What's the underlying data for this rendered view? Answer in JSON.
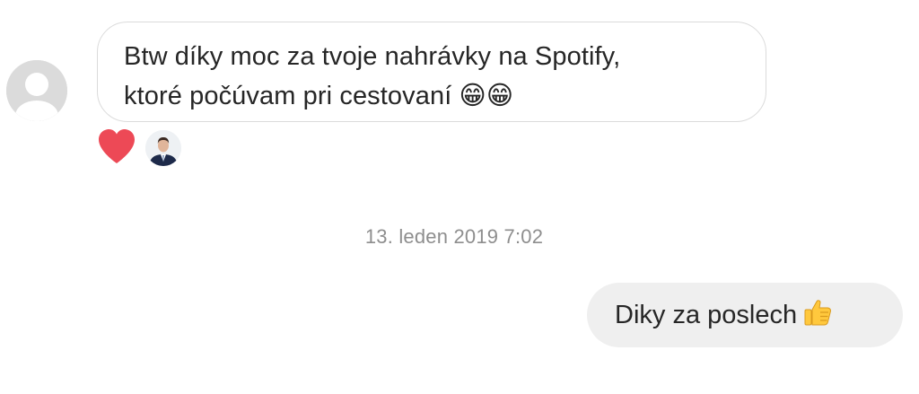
{
  "thread": {
    "incoming": {
      "line1": "Btw díky moc za tvoje nahrávky na Spotify,",
      "line2": "ktoré počúvam pri cestovaní",
      "emoji": "😁😁",
      "reactions": [
        "heart-icon"
      ]
    },
    "timestamp": "13. leden 2019 7:02",
    "outgoing": {
      "text": "Diky za poslech",
      "emoji_icon": "thumbs-up-icon"
    }
  },
  "colors": {
    "incoming_border": "#dbdbdb",
    "outgoing_bg": "#efefef",
    "timestamp": "#8e8e8e",
    "heart": "#ed4956",
    "avatar_placeholder": "#dbdbdb"
  }
}
